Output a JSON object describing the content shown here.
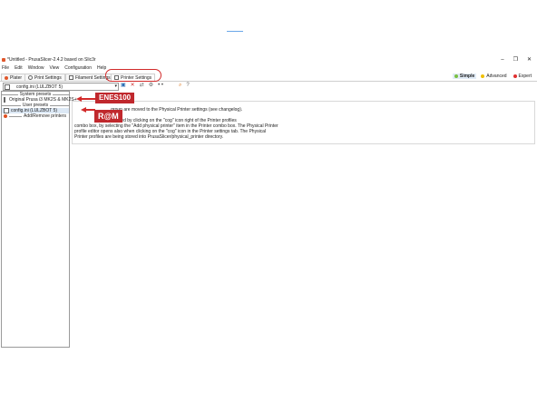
{
  "window": {
    "title": "*Untitled - PrusaSlicer-2.4.2 based on Slic3r",
    "controls": [
      "–",
      "❐",
      "✕"
    ]
  },
  "menu": [
    "File",
    "Edit",
    "Window",
    "View",
    "Configuration",
    "Help"
  ],
  "tabs": [
    {
      "label": "Plater",
      "icon": "plater-icon"
    },
    {
      "label": "Print Settings",
      "icon": "gear-icon"
    },
    {
      "label": "Filament Settings",
      "icon": "spool-icon"
    },
    {
      "label": "Printer Settings",
      "icon": "printer-icon",
      "active": true
    }
  ],
  "modes": [
    {
      "label": "Simple",
      "color": "#7bc043",
      "selected": true
    },
    {
      "label": "Advanced",
      "color": "#f0c000"
    },
    {
      "label": "Expert",
      "color": "#e03030"
    }
  ],
  "preset": {
    "selected": "config.ini (LULZBOT 5)"
  },
  "toolbar_icons": [
    "save-icon",
    "delete-icon",
    "compare-icon",
    "search-icon"
  ],
  "left_panel": {
    "system_header": "System presets",
    "system_item": "Original Prusa i3 MK2S & MK2S+",
    "user_header": "User presets",
    "user_item": "config.ini (LULZBOT 5)",
    "add_remove": "Add/Remove printers"
  },
  "annotations": {
    "a1": "ENES100",
    "a2": "R@M"
  },
  "info": {
    "line1": "...group are moved to the Physical Printer settings (see changelog).",
    "line2": "...created by clicking on the \"cog\" icon right of the Printer profiles",
    "line3": "combo box, by selecting the \"Add physical printer\" item in the Printer combo box. The Physical Printer",
    "line4": "profile editor opens also when clicking on the \"cog\" icon in the Printer settings tab. The Physical",
    "line5": "Printer profiles are being stored into PrusaSlicer/physical_printer directory."
  }
}
